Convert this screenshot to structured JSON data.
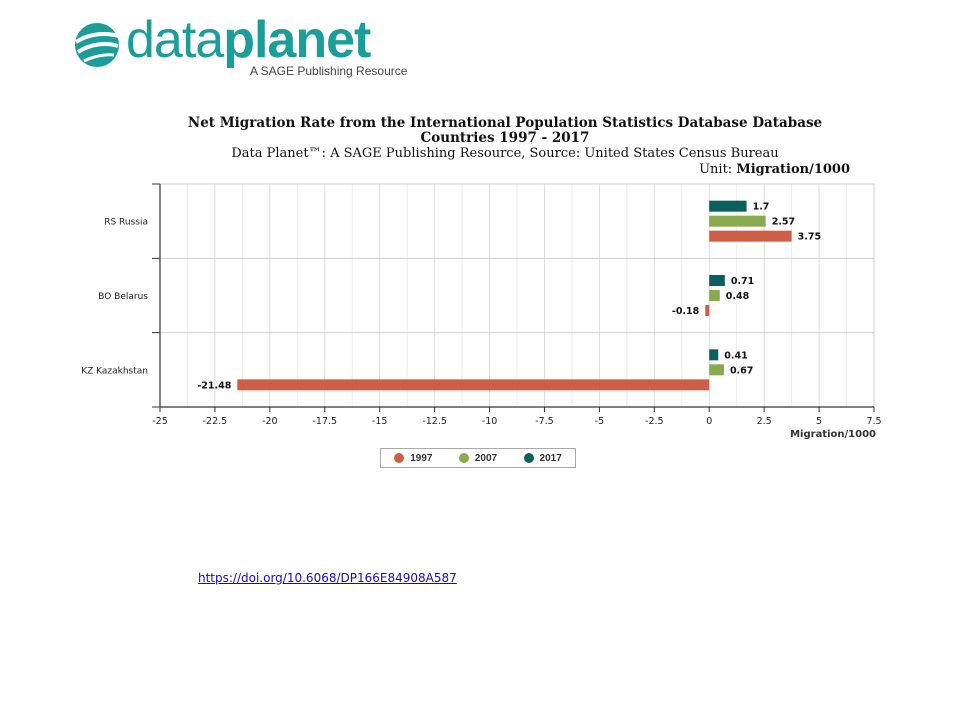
{
  "brand": {
    "word_light": "data",
    "word_bold": "planet",
    "tagline": "A SAGE Publishing Resource",
    "color": "#1b9e9a"
  },
  "chart_data": {
    "type": "bar",
    "orientation": "horizontal",
    "title_line1": "Net Migration Rate from the International Population Statistics Database Database",
    "title_line2": "Countries 1997 - 2017",
    "subtitle": "Data Planet™: A SAGE Publishing Resource, Source: United States Census Bureau",
    "unit_label": "Unit: ",
    "unit_value": "Migration/1000",
    "xlabel": "Migration/1000",
    "xlim": [
      -25,
      7.5
    ],
    "xticks": [
      -25,
      -22.5,
      -20,
      -17.5,
      -15,
      -12.5,
      -10,
      -7.5,
      -5,
      -2.5,
      0,
      2.5,
      5,
      7.5
    ],
    "categories": [
      "RS Russia",
      "BO Belarus",
      "KZ Kazakhstan"
    ],
    "series": [
      {
        "name": "2017",
        "color": "#0b5f5c",
        "values": [
          1.7,
          0.71,
          0.41
        ],
        "labels": [
          "1.7",
          "0.71",
          "0.41"
        ]
      },
      {
        "name": "2007",
        "color": "#8aaa4f",
        "values": [
          2.57,
          0.48,
          0.67
        ],
        "labels": [
          "2.57",
          "0.48",
          "0.67"
        ]
      },
      {
        "name": "1997",
        "color": "#cc5f45",
        "values": [
          3.75,
          -0.18,
          -21.48
        ],
        "labels": [
          "3.75",
          "-0.18",
          "-21.48"
        ]
      }
    ],
    "legend_order": [
      "1997",
      "2007",
      "2017"
    ],
    "grid": true,
    "legend_position": "bottom-center"
  },
  "legend": {
    "items": [
      {
        "label": "1997",
        "color": "#cc5f45"
      },
      {
        "label": "2007",
        "color": "#8aaa4f"
      },
      {
        "label": "2017",
        "color": "#0b5f5c"
      }
    ]
  },
  "doi": {
    "text": "https://doi.org/10.6068/DP166E84908A587"
  }
}
